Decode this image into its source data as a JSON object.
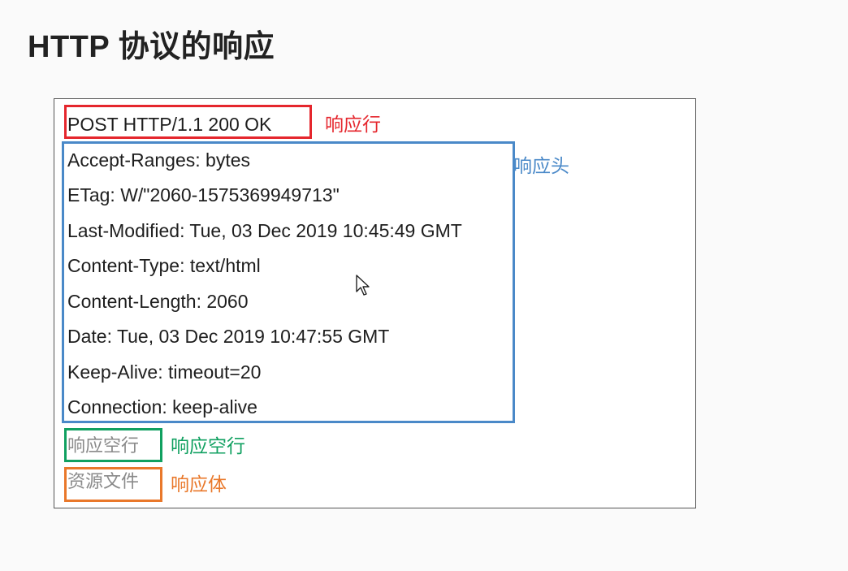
{
  "slide": {
    "title": "HTTP 协议的响应"
  },
  "response": {
    "status_line": "POST HTTP/1.1 200 OK",
    "headers": [
      "Accept-Ranges: bytes",
      "ETag: W/\"2060-1575369949713\"",
      "Last-Modified: Tue, 03 Dec 2019 10:45:49 GMT",
      "Content-Type: text/html",
      "Content-Length: 2060",
      "Date: Tue, 03 Dec 2019 10:47:55 GMT",
      "Keep-Alive: timeout=20",
      "Connection: keep-alive"
    ],
    "blank_line_text": "响应空行",
    "body_text": "资源文件"
  },
  "annotations": {
    "status_line_label": "响应行",
    "headers_label": "响应头",
    "blank_line_label": "响应空行",
    "body_label": "响应体"
  },
  "colors": {
    "status_line": "#e5262d",
    "headers": "#4a89c8",
    "blank_line": "#10a060",
    "body": "#e9782a"
  },
  "icons": {
    "cursor": "mouse-pointer-icon"
  }
}
